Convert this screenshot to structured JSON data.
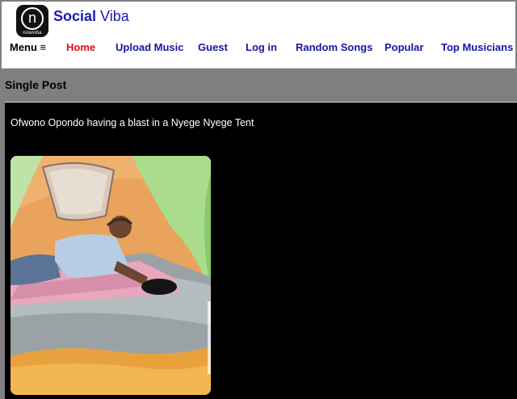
{
  "brand": {
    "logo_text": "nowviba",
    "title_bold": "Social",
    "title_rest": "Viba"
  },
  "nav": {
    "menu_label": "Menu ≡",
    "items": [
      {
        "label": "Home"
      },
      {
        "label": "Upload Music"
      },
      {
        "label": "Guest"
      },
      {
        "label": "Log in"
      },
      {
        "label": "Random Songs"
      },
      {
        "label": "Popular"
      },
      {
        "label": "Top Musicians"
      }
    ]
  },
  "page": {
    "section_title": "Single Post",
    "post_caption": "Ofwono Opondo having a blast in a Nyege Nyege Tent"
  },
  "colors": {
    "nav_link": "#1515a8",
    "nav_active": "#e01010",
    "title": "#1a1ab8"
  }
}
